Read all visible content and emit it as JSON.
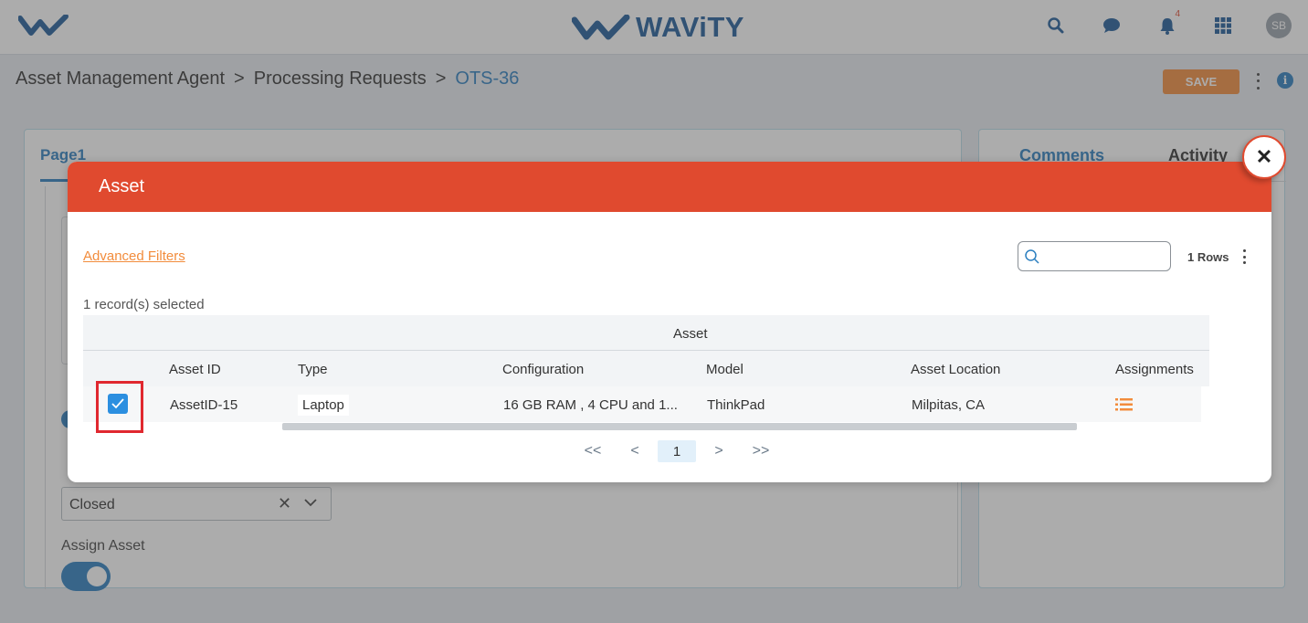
{
  "app": {
    "brand": "WAViTY",
    "notification_count": "4",
    "user_initials": "SB"
  },
  "breadcrumb": {
    "items": [
      "Asset Management Agent",
      "Processing Requests"
    ],
    "separator": ">",
    "current": "OTS-36"
  },
  "toolbar": {
    "save_label": "SAVE"
  },
  "form": {
    "page_tab": "Page1",
    "status_value": "Closed",
    "assign_asset_label": "Assign Asset",
    "assign_asset_on": true
  },
  "side_panel": {
    "tabs": [
      "Comments",
      "Activity"
    ]
  },
  "modal": {
    "title": "Asset",
    "advanced_filters": "Advanced Filters",
    "search_placeholder": "",
    "rows_label": "1 Rows",
    "selected_text": "1 record(s) selected",
    "group_header": "Asset",
    "columns": [
      "Asset ID",
      "Type",
      "Configuration",
      "Model",
      "Asset Location",
      "Assignments"
    ],
    "rows": [
      {
        "selected": true,
        "asset_id": "AssetID-15",
        "type": "Laptop",
        "configuration": "16 GB RAM , 4 CPU and 1...",
        "model": "ThinkPad",
        "location": "Milpitas, CA"
      }
    ],
    "pagination": {
      "first": "<<",
      "prev": "<",
      "current": "1",
      "next": ">",
      "last": ">>"
    }
  },
  "colors": {
    "brand_blue": "#1f5c99",
    "link_blue": "#2c7fc0",
    "modal_header": "#e04a2f",
    "accent_orange": "#f28c3c",
    "highlight_red": "#e0282f"
  }
}
